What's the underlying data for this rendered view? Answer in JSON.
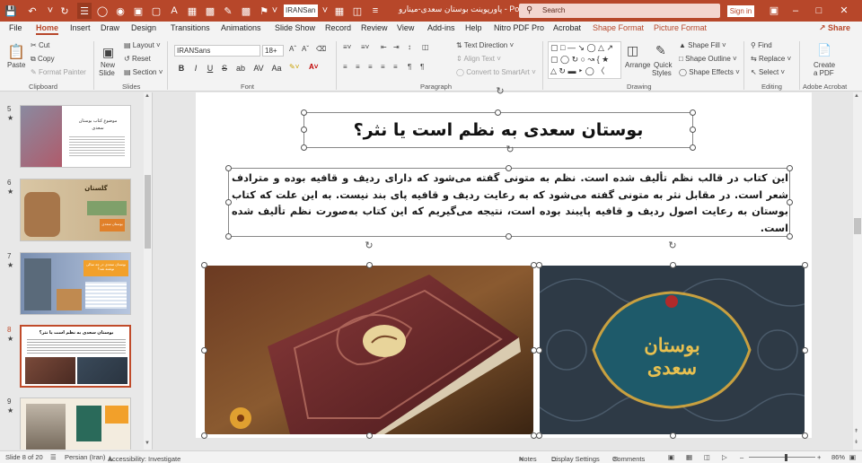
{
  "titlebar": {
    "font_box": "IRANSan",
    "doc_title": "پاورپوینت بوستان سعدی-مینارو",
    "app_name": "PowerPoint",
    "search_placeholder": "Search",
    "signin": "Sign in"
  },
  "tabs": [
    "File",
    "Home",
    "Insert",
    "Draw",
    "Design",
    "Transitions",
    "Animations",
    "Slide Show",
    "Record",
    "Review",
    "View",
    "Add-ins",
    "Help",
    "Nitro PDF Pro",
    "Acrobat",
    "Shape Format",
    "Picture Format"
  ],
  "active_tab": "Home",
  "share": "Share",
  "ribbon": {
    "clipboard": {
      "paste": "Paste",
      "cut": "Cut",
      "copy": "Copy",
      "format_painter": "Format Painter",
      "label": "Clipboard"
    },
    "slides": {
      "new_slide": "New",
      "new_slide2": "Slide",
      "layout": "Layout",
      "reset": "Reset",
      "section": "Section",
      "label": "Slides"
    },
    "font": {
      "name": "IRANSans",
      "size": "18+",
      "label": "Font",
      "bold": "B",
      "italic": "I",
      "underline": "U",
      "strike": "S",
      "shadow": "ab",
      "spacing": "AV",
      "case": "Aa"
    },
    "paragraph": {
      "text_direction": "Text Direction",
      "align_text": "Align Text",
      "convert": "Convert to SmartArt",
      "label": "Paragraph"
    },
    "drawing": {
      "arrange": "Arrange",
      "quick_styles": "Quick",
      "quick_styles2": "Styles",
      "shape_fill": "Shape Fill",
      "shape_outline": "Shape Outline",
      "shape_effects": "Shape Effects",
      "label": "Drawing"
    },
    "editing": {
      "find": "Find",
      "replace": "Replace",
      "select": "Select",
      "label": "Editing"
    },
    "adobe": {
      "create_pdf": "Create",
      "create_pdf2": "a PDF",
      "label": "Adobe Acrobat"
    }
  },
  "thumbnails": [
    {
      "num": "5",
      "title": "موضوع کتاب بوستان",
      "sub": "سعدی"
    },
    {
      "num": "6",
      "title": "گلستان",
      "sub": "بوستان سعدی"
    },
    {
      "num": "7",
      "title": "بوستان سعدی در چه سالی نوشته شد؟",
      "sub": ""
    },
    {
      "num": "8",
      "title": "بوستان سعدی به نظم است یا نثر؟",
      "sub": ""
    },
    {
      "num": "9",
      "title": "",
      "sub": ""
    }
  ],
  "selected_thumb": "8",
  "slide": {
    "title": "بوستان سعدی به نظم است یا نثر؟",
    "body": "این کتاب در قالب نظم تألیف شده است. نظم به متونی گفته می‌شود که دارای ردیف و قافیه بوده و مترادف شعر است. در مقابل نثر به متونی گفته می‌شود که به رعایت ردیف و قافیه پای بند نیست. به این علت که کتاب بوستان به رعایت اصول ردیف و قافیه پایبند بوده است، نتیجه می‌گیریم که این کتاب به‌صورت نظم تألیف شده است.",
    "right_image_text": "بوستان سعدی"
  },
  "status": {
    "slide_info": "Slide 8 of 20",
    "language": "Persian (Iran)",
    "accessibility": "Accessibility: Investigate",
    "notes": "Notes",
    "display": "Display Settings",
    "comments": "Comments",
    "zoom": "86%"
  },
  "colors": {
    "accent": "#b7472a",
    "selected_border": "#c04b2a"
  }
}
